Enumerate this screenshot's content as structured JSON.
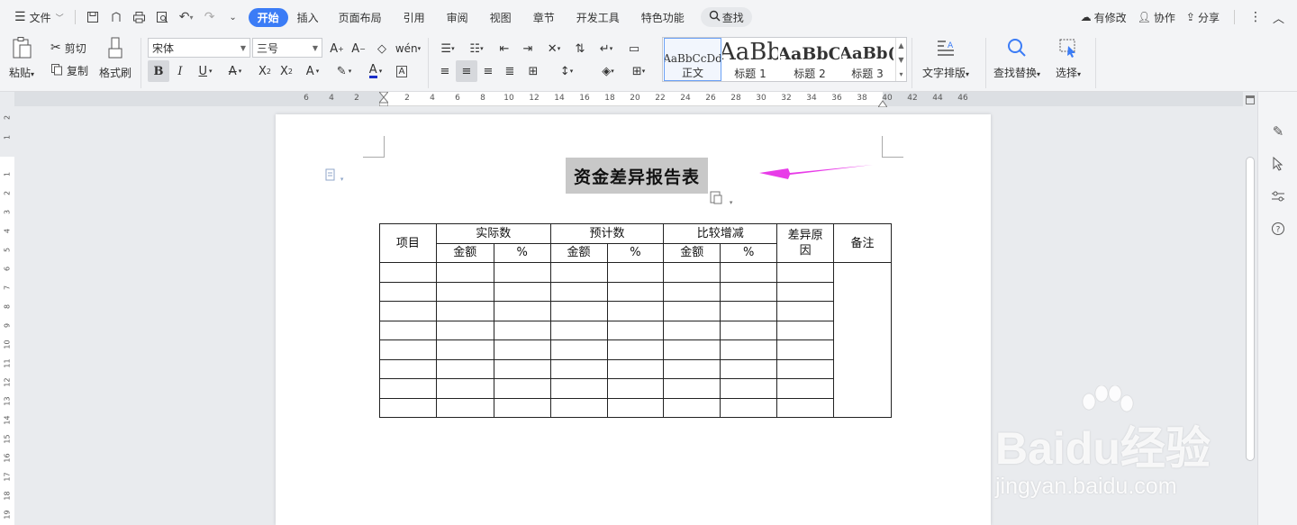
{
  "menubar": {
    "file_label": "文件",
    "tabs": [
      "开始",
      "插入",
      "页面布局",
      "引用",
      "审阅",
      "视图",
      "章节",
      "开发工具",
      "特色功能"
    ],
    "search_label": "查找",
    "right": {
      "changes": "有修改",
      "collab": "协作",
      "share": "分享"
    }
  },
  "ribbon": {
    "paste": "粘贴",
    "cut": "剪切",
    "copy": "复制",
    "format_painter": "格式刷",
    "font_name": "宋体",
    "font_size": "三号",
    "styles": [
      {
        "preview": "AaBbCcDd",
        "name": "正文"
      },
      {
        "preview": "AaBb",
        "name": "标题 1"
      },
      {
        "preview": "AaBbC",
        "name": "标题 2"
      },
      {
        "preview": "AaBb(",
        "name": "标题 3"
      }
    ],
    "text_layout": "文字排版",
    "find_replace": "查找替换",
    "select": "选择"
  },
  "ruler": {
    "h_ticks": [
      "6",
      "4",
      "2",
      "2",
      "4",
      "6",
      "8",
      "10",
      "12",
      "14",
      "16",
      "18",
      "20",
      "22",
      "24",
      "26",
      "28",
      "30",
      "32",
      "34",
      "36",
      "38",
      "40",
      "42",
      "44",
      "46"
    ],
    "v_ticks": [
      "2",
      "1",
      "1",
      "2",
      "3",
      "4",
      "5",
      "6",
      "7",
      "8",
      "9",
      "10",
      "11",
      "12",
      "13",
      "14",
      "15",
      "16",
      "17",
      "18",
      "19"
    ]
  },
  "document": {
    "title": "资金差异报告表",
    "table": {
      "h_item": "项目",
      "h_actual": "实际数",
      "h_budget": "预计数",
      "h_compare": "比较增减",
      "h_reason": "差异原因",
      "h_note": "备注",
      "sub_amount": "金额",
      "sub_percent": "%"
    }
  },
  "watermark": {
    "main": "Baidu经验",
    "sub": "jingyan.baidu.com"
  },
  "colors": {
    "accent": "#3b7cf6",
    "arrow": "#e83ce8"
  }
}
